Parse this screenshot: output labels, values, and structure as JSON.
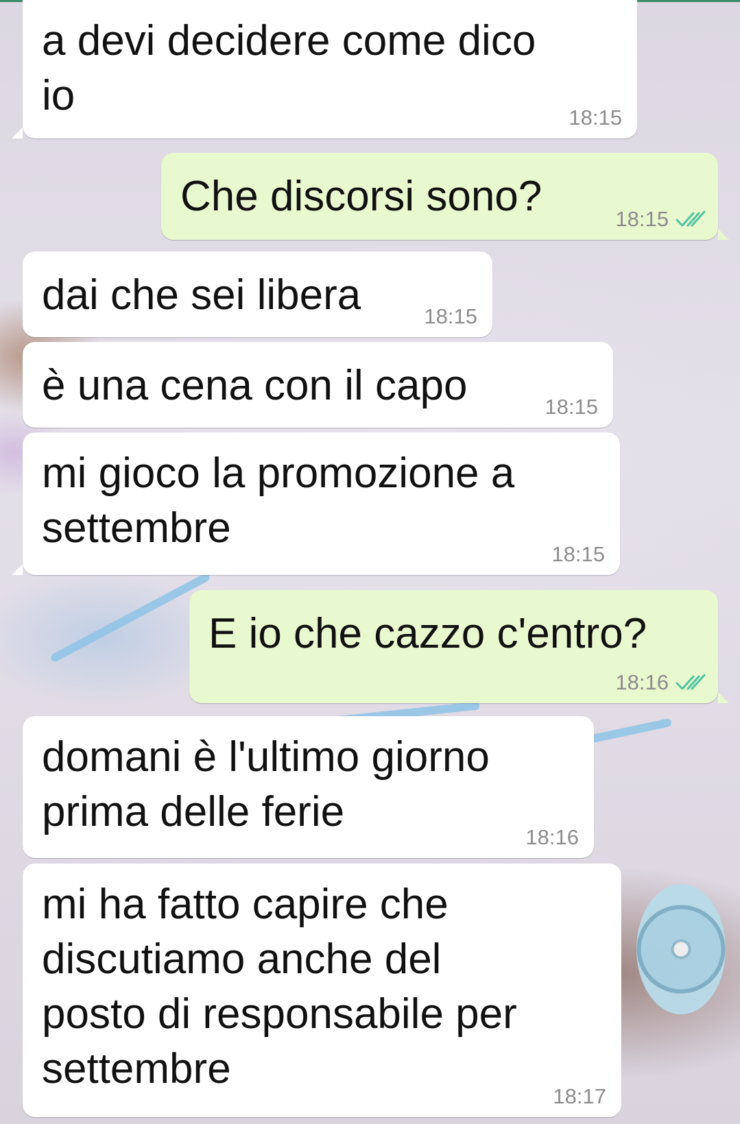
{
  "messages": [
    {
      "direction": "in",
      "text": "a devi decidere come dico\nio",
      "time": "18:15"
    },
    {
      "direction": "out",
      "text": "Che discorsi sono?",
      "time": "18:15",
      "status": "read"
    },
    {
      "direction": "in",
      "text": "dai che sei libera",
      "time": "18:15"
    },
    {
      "direction": "in",
      "text": "è una cena con il capo",
      "time": "18:15"
    },
    {
      "direction": "in",
      "text": "mi gioco la promozione a\nsettembre",
      "time": "18:15"
    },
    {
      "direction": "out",
      "text": "E io che cazzo c'entro?",
      "time": "18:16",
      "status": "read"
    },
    {
      "direction": "in",
      "text": "domani è l'ultimo giorno\nprima delle ferie",
      "time": "18:16"
    },
    {
      "direction": "in",
      "text": "mi ha fatto capire che\ndiscutiamo anche del\nposto di responsabile per\nsettembre",
      "time": "18:17"
    }
  ],
  "colors": {
    "incoming_bubble": "#ffffff",
    "outgoing_bubble": "#e8f8cf",
    "read_ticks": "#4fc3a1",
    "timestamp": "#8c8c8c"
  },
  "icons": {
    "read_status": "double-check-icon"
  }
}
